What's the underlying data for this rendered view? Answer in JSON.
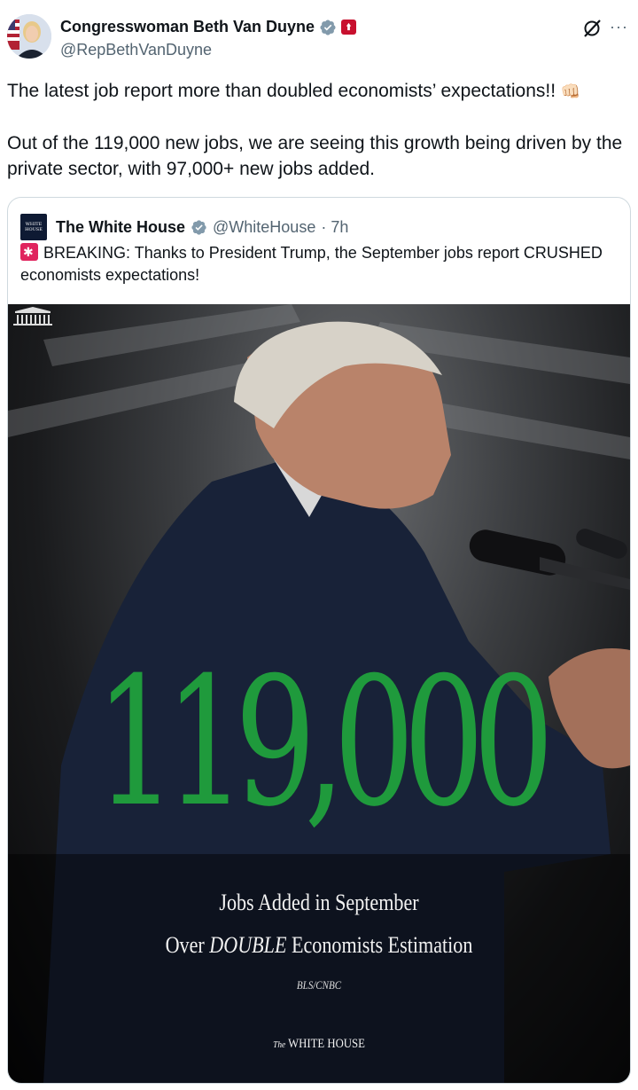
{
  "author": {
    "display_name": "Congresswoman Beth Van Duyne",
    "handle": "@RepBethVanDuyne",
    "verified": true,
    "affiliation_badge": "us-house-seal"
  },
  "icons": {
    "grok": "grok-icon",
    "more": "more-options-icon"
  },
  "tweet": {
    "paragraph1": "The latest job report more than doubled economists’ expectations!!",
    "paragraph1_emoji": "👊🏻",
    "paragraph2": "Out of the 119,000 new jobs, we are seeing this growth being driven by the private sector, with 97,000+ new jobs added."
  },
  "quoted": {
    "logo_text": "WHITE HOUSE",
    "display_name": "The White House",
    "verified": true,
    "handle": "@WhiteHouse",
    "time": "· 7h",
    "text": "BREAKING: Thanks to President Trump, the September jobs report CRUSHED economists expectations!",
    "text_emoji": "🚨",
    "media": {
      "big_number": "119,000",
      "line1": "Jobs Added in September",
      "line2_prefix": "Over ",
      "line2_emph": "DOUBLE",
      "line2_suffix": " Economists Estimation",
      "source": "BLS/CNBC",
      "footer_small": "The",
      "footer_main": "WHITE HOUSE",
      "number_color": "#1f9a3c"
    }
  }
}
